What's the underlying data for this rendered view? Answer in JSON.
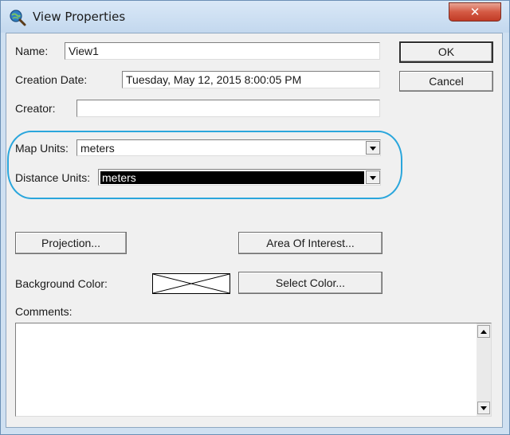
{
  "window": {
    "title": "View Properties",
    "close_label": "✕"
  },
  "fields": {
    "name_label": "Name:",
    "name_value": "View1",
    "creation_date_label": "Creation Date:",
    "creation_date_value": "Tuesday, May 12, 2015 8:00:05 PM",
    "creator_label": "Creator:",
    "creator_value": ""
  },
  "units": {
    "map_units_label": "Map Units:",
    "map_units_value": "meters",
    "distance_units_label": "Distance Units:",
    "distance_units_value": "meters"
  },
  "buttons": {
    "ok": "OK",
    "cancel": "Cancel",
    "projection": "Projection...",
    "area_of_interest": "Area Of Interest...",
    "select_color": "Select Color..."
  },
  "background": {
    "label": "Background Color:"
  },
  "comments": {
    "label": "Comments:",
    "value": ""
  },
  "colors": {
    "highlight": "#2aa6dc",
    "close_button": "#c13b26"
  }
}
